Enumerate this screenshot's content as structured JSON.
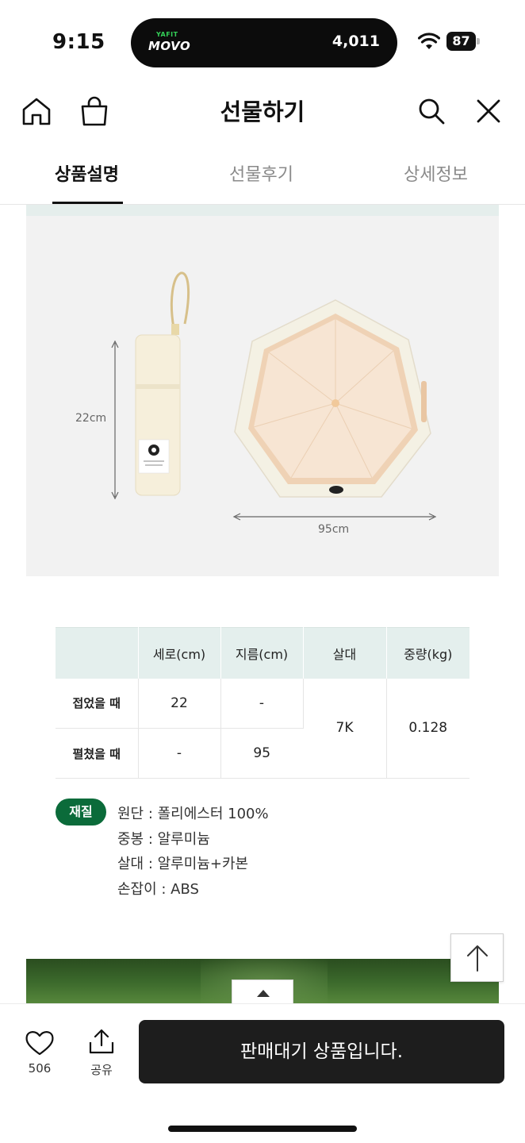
{
  "status_bar": {
    "time": "9:15",
    "island_brand_top": "YAFIT",
    "island_brand_main": "MOVO",
    "island_count": "4,011",
    "battery": "87",
    "wifi_icon": "wifi-icon"
  },
  "header": {
    "title": "선물하기",
    "icons": [
      "home-icon",
      "shopping-bag-icon",
      "search-icon",
      "close-icon"
    ]
  },
  "tabs": [
    {
      "label": "상품설명",
      "active": true
    },
    {
      "label": "선물후기",
      "active": false
    },
    {
      "label": "상세정보",
      "active": false
    }
  ],
  "product_image": {
    "height_label": "22cm",
    "width_label": "95cm"
  },
  "spec_table": {
    "headers": [
      "",
      "세로(cm)",
      "지름(cm)",
      "살대",
      "중량(kg)"
    ],
    "rows": [
      {
        "label": "접었을 때",
        "height": "22",
        "diameter": "-"
      },
      {
        "label": "펼쳤을 때",
        "height": "-",
        "diameter": "95"
      }
    ],
    "ribs": "7K",
    "weight": "0.128"
  },
  "material": {
    "badge": "재질",
    "items": [
      "원단 : 폴리에스터 100%",
      "중봉 : 알루미늄",
      "살대 : 알루미늄+카본",
      "손잡이 : ABS"
    ]
  },
  "bottom_bar": {
    "like_count": "506",
    "share_label": "공유",
    "cta_label": "판매대기 상품입니다."
  },
  "colors": {
    "accent_green": "#0b6b3a",
    "table_header_bg": "#e4efed",
    "cta_bg": "#1d1d1d",
    "umbrella_fabric": "#f6e3d1",
    "umbrella_trim": "#f4f1e4"
  }
}
